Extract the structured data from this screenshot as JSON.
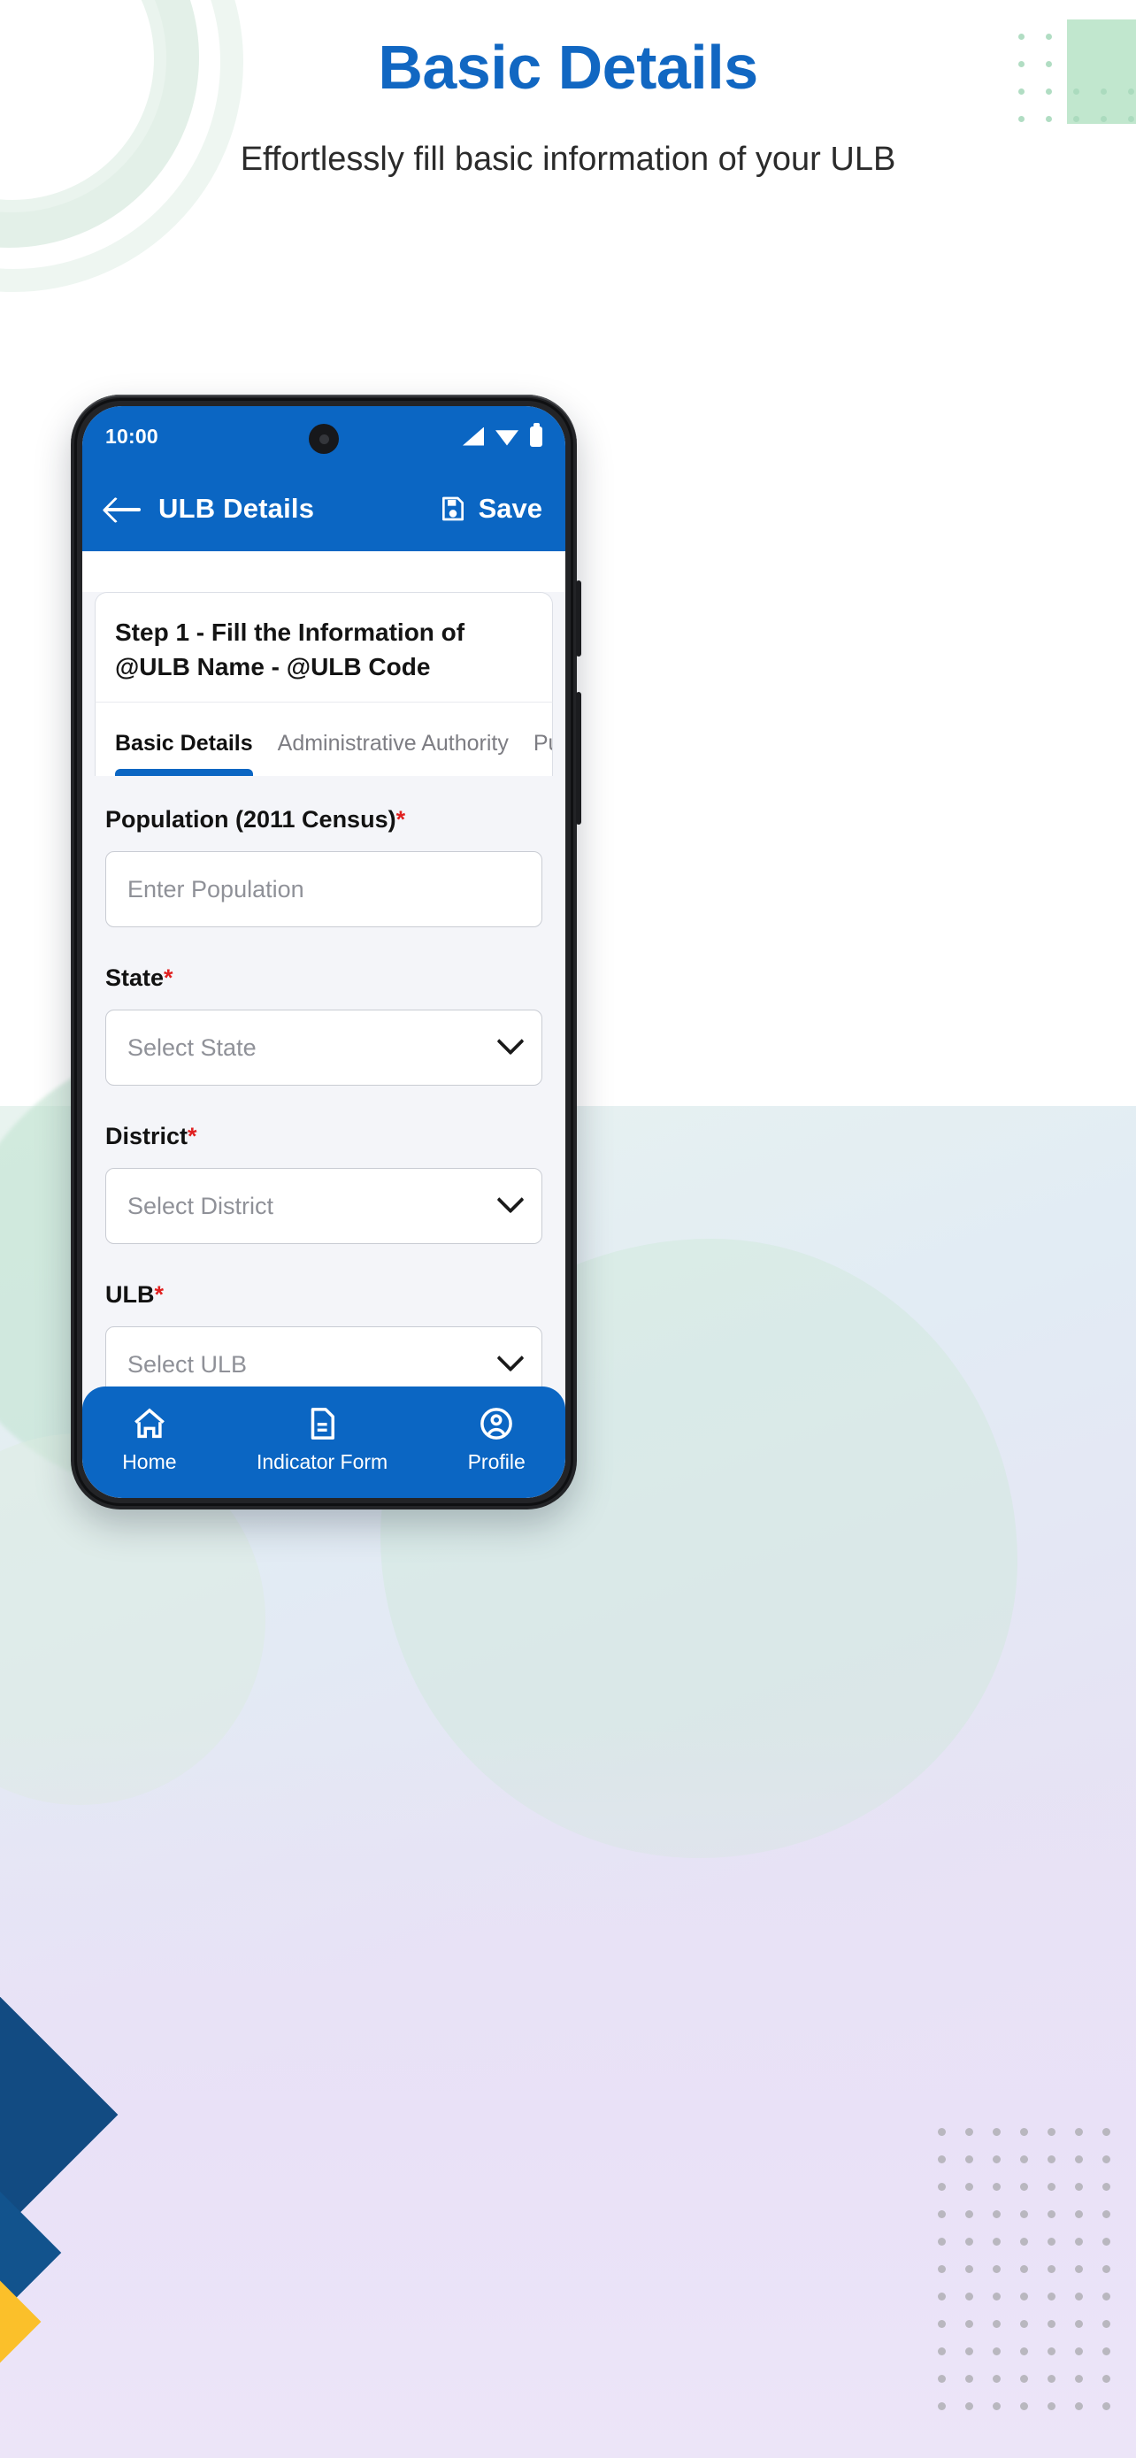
{
  "hero": {
    "title": "Basic Details",
    "subtitle": "Effortlessly fill basic information of your ULB",
    "title_color": "#1167c2"
  },
  "phone": {
    "statusbar": {
      "time": "10:00",
      "icons": [
        "signal-icon",
        "wifi-icon",
        "battery-icon"
      ]
    },
    "appbar": {
      "back_icon": "back-arrow-icon",
      "title": "ULB Details",
      "save_icon": "save-disk-icon",
      "save_label": "Save",
      "background": "#0b66c3"
    },
    "step_card": {
      "text": "Step 1 - Fill the Information of @ULB Name - @ULB Code"
    },
    "tabs": [
      {
        "label": "Basic Details",
        "active": true
      },
      {
        "label": "Administrative Authority",
        "active": false
      },
      {
        "label": "Publ",
        "active": false
      }
    ],
    "form": {
      "fields": [
        {
          "label": "Population (2011 Census)",
          "required": true,
          "type": "text",
          "placeholder": "Enter Population",
          "value": ""
        },
        {
          "label": "State",
          "required": true,
          "type": "select",
          "placeholder": "Select State",
          "value": ""
        },
        {
          "label": "District",
          "required": true,
          "type": "select",
          "placeholder": "Select District",
          "value": ""
        },
        {
          "label": "ULB",
          "required": true,
          "type": "select",
          "placeholder": "Select ULB",
          "value": ""
        }
      ],
      "required_marker": "*"
    },
    "bottom_nav": [
      {
        "label": "Home",
        "icon": "home-icon"
      },
      {
        "label": "Indicator Form",
        "icon": "document-icon"
      },
      {
        "label": "Profile",
        "icon": "profile-icon"
      }
    ]
  },
  "decor": {
    "green_accent": "#b6e3c6",
    "dot_green": "#a9d9bd",
    "dot_grey": "#a8a8ac",
    "chevron_blue": "#124b82",
    "chevron_yellow": "#fbc02a"
  }
}
